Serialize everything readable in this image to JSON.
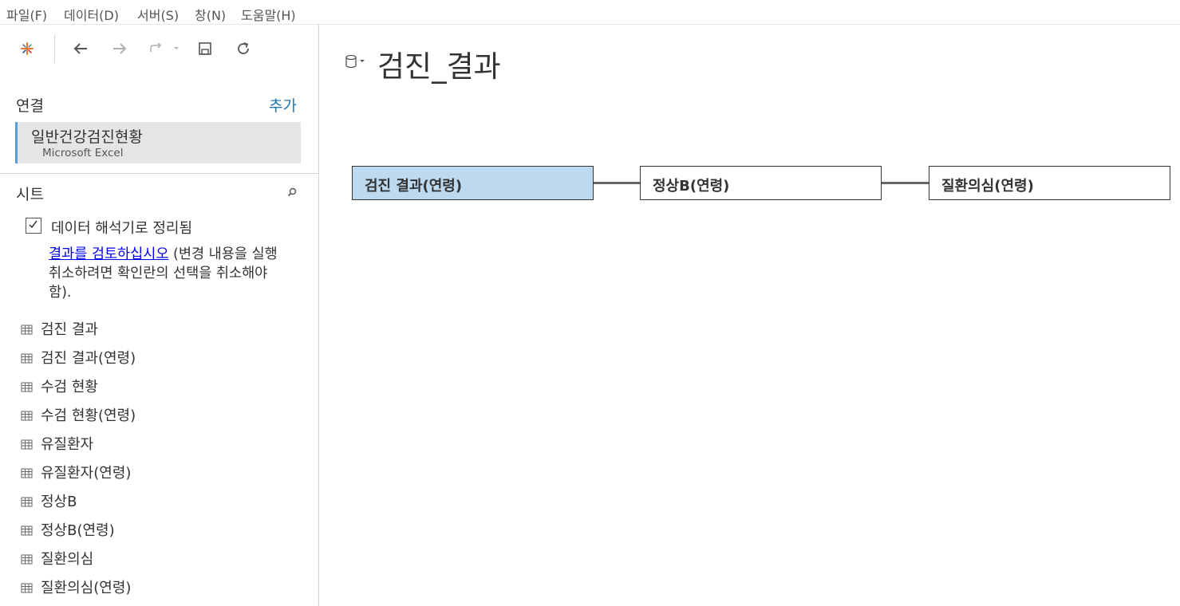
{
  "menu": {
    "items": [
      "파일(F)",
      "데이터(D)",
      "서버(S)",
      "창(N)",
      "도움말(H)"
    ]
  },
  "toolbar": {
    "icons": [
      "tableau-logo-icon",
      "back-icon",
      "forward-icon",
      "redo-icon",
      "save-icon",
      "refresh-icon"
    ]
  },
  "connections": {
    "label": "연결",
    "add_label": "추가",
    "items": [
      {
        "name": "일반건강검진현황",
        "type": "Microsoft Excel"
      }
    ]
  },
  "sheets": {
    "label": "시트",
    "interpreter_checked": true,
    "interpreter_label": "데이터 해석기로 정리됨",
    "review_link": "결과를 검토하십시오",
    "review_note": " (변경 내용을 실행 취소하려면 확인란의 선택을 취소해야 함).",
    "items": [
      "검진 결과",
      "검진 결과(연령)",
      "수검 현황",
      "수검 현황(연령)",
      "유질환자",
      "유질환자(연령)",
      "정상B",
      "정상B(연령)",
      "질환의심",
      "질환의심(연령)"
    ]
  },
  "canvas": {
    "datasource_title": "검진_결과",
    "tables": [
      {
        "label": "검진 결과(연령)",
        "selected": true
      },
      {
        "label": "정상B(연령)",
        "selected": false
      },
      {
        "label": "질환의심(연령)",
        "selected": false
      }
    ]
  },
  "colors": {
    "accent_link": "#1f77b4",
    "selected_table": "#bcd9f0",
    "connection_bar": "#5b9bd5"
  }
}
